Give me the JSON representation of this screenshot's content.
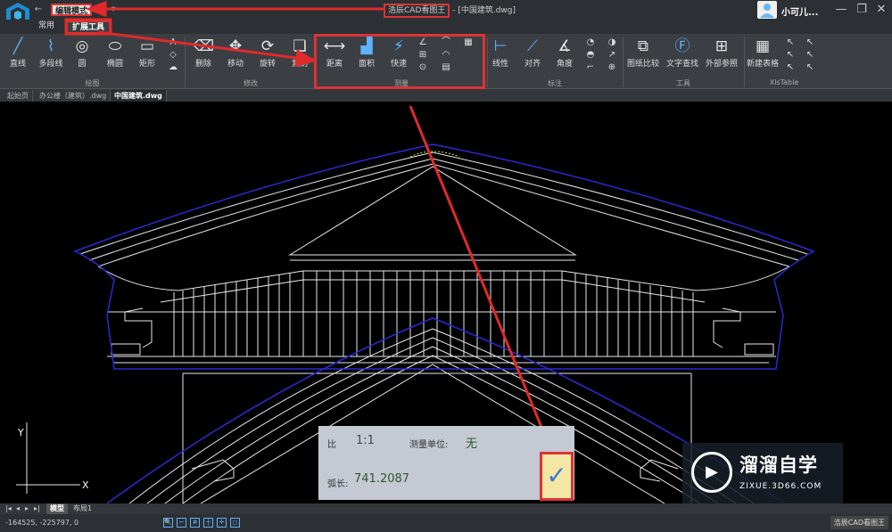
{
  "titlebar": {
    "mode_button": "编辑模式",
    "app_title": "浩辰CAD看图王",
    "doc_title": " - [中国建筑.dwg]",
    "user_name": "小可儿...",
    "back_arrow": "←",
    "redo_arrow": "↷",
    "dropdown": "▾",
    "min_glyph": "—",
    "max_glyph": "❐",
    "close_glyph": "✕"
  },
  "menu_tabs": [
    "常用",
    "扩展工具"
  ],
  "ribbon": {
    "draw": {
      "group_label": "绘图",
      "tools": [
        {
          "label": "直线",
          "icon": "line-icon",
          "glyph": "╱"
        },
        {
          "label": "多段线",
          "icon": "polyline-icon",
          "glyph": "⌇"
        },
        {
          "label": "圆",
          "icon": "circle-icon",
          "glyph": "◎"
        },
        {
          "label": "椭圆",
          "icon": "ellipse-icon",
          "glyph": "⬭"
        },
        {
          "label": "矩形",
          "icon": "rectangle-icon",
          "glyph": "▭"
        }
      ]
    },
    "draw_small": [
      {
        "icon": "text-icon",
        "glyph": "A"
      },
      {
        "icon": "eraser-icon",
        "glyph": "◇"
      },
      {
        "icon": "cloud-icon",
        "glyph": "☁"
      }
    ],
    "modify": {
      "group_label": "修改",
      "tools": [
        {
          "label": "删除",
          "icon": "eraser-icon",
          "glyph": "⌫"
        },
        {
          "label": "移动",
          "icon": "move-icon",
          "glyph": "✥"
        },
        {
          "label": "旋转",
          "icon": "rotate-icon",
          "glyph": "⟳"
        },
        {
          "label": "复制",
          "icon": "copy-icon",
          "glyph": "❏"
        }
      ]
    },
    "measure": {
      "group_label": "测量",
      "tools": [
        {
          "label": "距离",
          "icon": "distance-icon",
          "glyph": "⟷"
        },
        {
          "label": "面积",
          "icon": "area-icon",
          "glyph": "▟"
        },
        {
          "label": "快速",
          "icon": "quick-measure-icon",
          "glyph": "⚡"
        }
      ]
    },
    "measure_small": [
      {
        "icon": "angle-measure-icon",
        "glyph": "∠"
      },
      {
        "icon": "arc-measure-icon",
        "glyph": "⌒"
      },
      {
        "icon": "ruler-icon",
        "glyph": "▦"
      },
      {
        "icon": "coordinate-icon",
        "glyph": "⊞"
      },
      {
        "icon": "arc-length-icon",
        "glyph": "◠"
      },
      {
        "icon": "radius-icon",
        "glyph": "⊙"
      },
      {
        "icon": "table-measure-icon",
        "glyph": "▤"
      }
    ],
    "annotate": {
      "group_label": "标注",
      "tools": [
        {
          "label": "线性",
          "icon": "linear-dim-icon",
          "glyph": "⊢"
        },
        {
          "label": "对齐",
          "icon": "aligned-dim-icon",
          "glyph": "⟋"
        },
        {
          "label": "角度",
          "icon": "angle-dim-icon",
          "glyph": "∡"
        }
      ]
    },
    "annotate_small": [
      {
        "icon": "radius-dim-icon",
        "glyph": "◔"
      },
      {
        "icon": "diameter-dim-icon",
        "glyph": "◑"
      },
      {
        "icon": "arc-dim-icon",
        "glyph": "◓"
      },
      {
        "icon": "leader-icon",
        "glyph": "↗"
      },
      {
        "icon": "ordinate-icon",
        "glyph": "⌐"
      },
      {
        "icon": "center-mark-icon",
        "glyph": "⊕"
      }
    ],
    "tools_group": {
      "group_label": "工具",
      "tools": [
        {
          "label": "图纸比较",
          "icon": "compare-icon",
          "glyph": "⧉"
        },
        {
          "label": "文字查找",
          "icon": "text-find-icon",
          "glyph": "Ⓕ"
        },
        {
          "label": "外部参照",
          "icon": "xref-icon",
          "glyph": "⊞"
        }
      ]
    },
    "xls": {
      "group_label": "XlsTable",
      "tools": [
        {
          "label": "新建表格",
          "icon": "table-icon",
          "glyph": "▦"
        }
      ]
    },
    "xls_small": [
      {
        "icon": "cursor-icon",
        "glyph": "↖"
      },
      {
        "icon": "cursor-icon",
        "glyph": "↖"
      },
      {
        "icon": "cursor-icon",
        "glyph": "↖"
      },
      {
        "icon": "cursor-icon",
        "glyph": "↖"
      },
      {
        "icon": "cursor-icon",
        "glyph": "↖"
      },
      {
        "icon": "cursor-icon",
        "glyph": "↖"
      }
    ]
  },
  "doc_tabs": [
    "起始页",
    "办公楼（建筑）.dwg",
    "中国建筑.dwg"
  ],
  "measure_panel": {
    "ratio_label": "比",
    "ratio_value": "1:1",
    "unit_label": "测量单位:",
    "unit_value": "无",
    "arc_label": "弧长:",
    "arc_value": "741.2087"
  },
  "confirm_glyph": "✓",
  "axis": {
    "x": "X",
    "y": "Y"
  },
  "watermark": {
    "title": "溜溜自学",
    "url": "ZIXUE.3D66.COM",
    "play_glyph": "▶"
  },
  "layout_tabs": [
    "模型",
    "布局1"
  ],
  "nav_arrows": [
    "|◂",
    "◂",
    "▸",
    "▸|"
  ],
  "status": {
    "coordinates": "-164525, -225797, 0",
    "brand": "浩辰CAD看图王"
  },
  "status_icons": [
    {
      "icon": "zoom-icon",
      "glyph": "🔍"
    },
    {
      "icon": "snap-icon",
      "glyph": "⌐"
    },
    {
      "icon": "grid-icon",
      "glyph": "#"
    },
    {
      "icon": "ortho-icon",
      "glyph": "┼"
    },
    {
      "icon": "polar-icon",
      "glyph": "✛"
    },
    {
      "icon": "osnap-icon",
      "glyph": "◻"
    }
  ],
  "colors": {
    "highlight": "#dd3333",
    "blue_outline": "#1a1aaa",
    "canvas": "#000000",
    "ribbon": "#3b3f44"
  }
}
